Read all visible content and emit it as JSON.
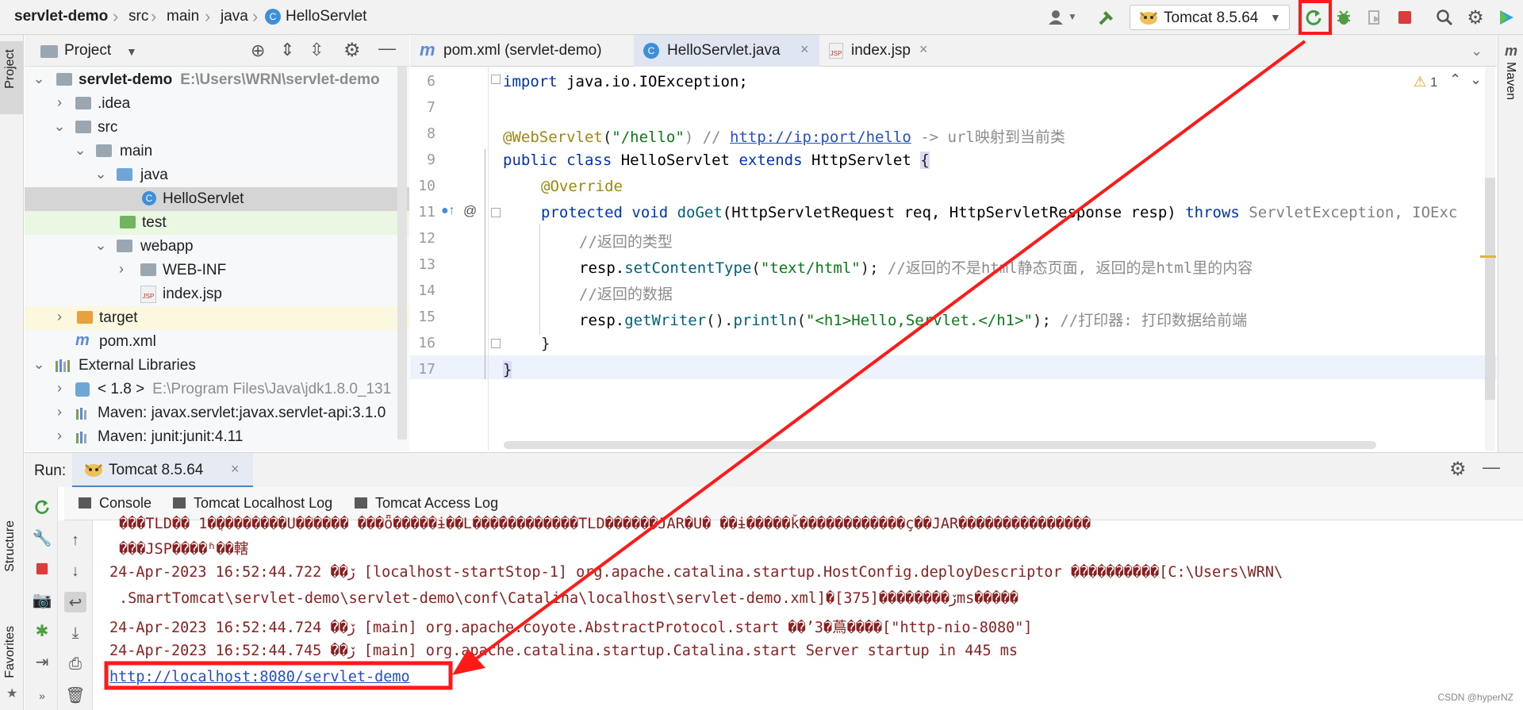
{
  "breadcrumb": {
    "items": [
      "servlet-demo",
      "src",
      "main",
      "java",
      "HelloServlet"
    ]
  },
  "toolbar": {
    "run_config": "Tomcat 8.5.64",
    "icons": [
      "user-icon",
      "hammer-icon",
      "tomcat-icon",
      "rerun-icon",
      "debug-icon",
      "coverage-icon",
      "stop-icon",
      "search-icon",
      "gear-icon",
      "update-icon"
    ]
  },
  "left_strip": {
    "project": "Project",
    "structure": "Structure",
    "favorites": "Favorites"
  },
  "right_strip": {
    "maven": "Maven"
  },
  "project_panel": {
    "title": "Project",
    "tree": [
      {
        "label": "servlet-demo",
        "path": "E:\\Users\\WRN\\servlet-demo"
      },
      {
        "label": ".idea"
      },
      {
        "label": "src"
      },
      {
        "label": "main"
      },
      {
        "label": "java"
      },
      {
        "label": "HelloServlet"
      },
      {
        "label": "test"
      },
      {
        "label": "webapp"
      },
      {
        "label": "WEB-INF"
      },
      {
        "label": "index.jsp"
      },
      {
        "label": "target"
      },
      {
        "label": "pom.xml"
      },
      {
        "label": "External Libraries"
      },
      {
        "label": "< 1.8 >",
        "path": "E:\\Program Files\\Java\\jdk1.8.0_131"
      },
      {
        "label": "Maven: javax.servlet:javax.servlet-api:3.1.0"
      },
      {
        "label": "Maven: junit:junit:4.11"
      }
    ]
  },
  "editor": {
    "tabs": [
      {
        "label": "pom.xml (servlet-demo)"
      },
      {
        "label": "HelloServlet.java"
      },
      {
        "label": "index.jsp"
      }
    ],
    "warnings": "1",
    "line_numbers": [
      "6",
      "7",
      "8",
      "9",
      "10",
      "11",
      "12",
      "13",
      "14",
      "15",
      "16",
      "17"
    ],
    "code": {
      "l6a": "import ",
      "l6b": "java.io.IOException;",
      "l8a": "@WebServlet",
      "l8b": "(",
      "l8c": "\"/hello\"",
      "l8d": ") // ",
      "l8e": "http://ip:port/hello",
      "l8f": " -> url映射到当前类",
      "l9a": "public class ",
      "l9b": "HelloServlet ",
      "l9c": "extends ",
      "l9d": "HttpServlet ",
      "l9e": "{",
      "l10": "@Override",
      "l11a": "protected void ",
      "l11b": "doGet",
      "l11c": "(HttpServletRequest req, HttpServletResponse resp) ",
      "l11d": "throws ",
      "l11e": "ServletException, IOExc",
      "l12": "//返回的类型",
      "l13a": "resp.",
      "l13b": "setContentType",
      "l13c": "(",
      "l13d": "\"text/html\"",
      "l13e": "); ",
      "l13f": "//返回的不是html静态页面, 返回的是html里的内容",
      "l14": "//返回的数据",
      "l15a": "resp.",
      "l15b": "getWriter",
      "l15c": "().",
      "l15d": "println",
      "l15e": "(",
      "l15f": "\"<h1>Hello,Servlet.</h1>\"",
      "l15g": "); ",
      "l15h": "//打印器: 打印数据给前端",
      "l16": "}",
      "l17": "}"
    }
  },
  "run_panel": {
    "label": "Run:",
    "tab": "Tomcat 8.5.64",
    "subtabs": [
      "Console",
      "Tomcat Localhost Log",
      "Tomcat Access Log"
    ],
    "log_lines": [
      "���TLD�� 1�ֲ��������U������ ���ȫ�����ɨ��Լ���ܵ���������TLD������JAR�U� ��ɨ�����ǩ������������ç��JAR���������������",
      "���JSP����ʱ��轄",
      "24-Apr-2023 16:52:44.722 ��ڒ [localhost-startStop-1] org.apache.catalina.startup.HostConfig.deployDescriptor ����������[C:\\Users\\WRN\\",
      ".SmartTomcat\\servlet-demo\\servlet-demo\\conf\\Catalina\\localhost\\servlet-demo.xml]�ڒ��������[375]ms�����",
      "24-Apr-2023 16:52:44.724 ��ڒ [main] org.apache.coyote.AbstractProtocol.start ��’З�蔦����[\"http-nio-8080\"]",
      "24-Apr-2023 16:52:44.745 ��ڒ [main] org.apache.catalina.startup.Catalina.start Server startup in 445 ms"
    ],
    "url": "http://localhost:8080/servlet-demo"
  },
  "watermark": "CSDN @hyperNZ",
  "colors": {
    "annotation_red": "#ff1a1a",
    "link_blue": "#2150c9",
    "log_red": "#8b1e1e"
  }
}
